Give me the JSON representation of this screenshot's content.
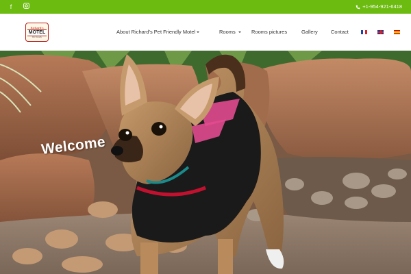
{
  "topbar": {
    "social": [
      {
        "icon": "facebook-icon",
        "glyph": "f"
      },
      {
        "icon": "instagram-icon",
        "glyph": "◘"
      }
    ],
    "phone_icon": "phone-icon",
    "phone": "+1-954-921-6418",
    "color": "#6cbb10"
  },
  "logo": {
    "line1": "Richard's",
    "line2": "MOTEL",
    "line3": "Pet Friendly"
  },
  "nav": {
    "items": [
      {
        "label": "About Richard's Pet Friendly Motel",
        "dropdown": true
      },
      {
        "label": "Rooms",
        "dropdown": true
      },
      {
        "label": "Rooms pictures",
        "dropdown": false
      },
      {
        "label": "Gallery",
        "dropdown": false
      },
      {
        "label": "Contact",
        "dropdown": false
      }
    ],
    "languages": [
      "fr",
      "en",
      "es"
    ]
  },
  "hero": {
    "heading": "Welcome"
  }
}
